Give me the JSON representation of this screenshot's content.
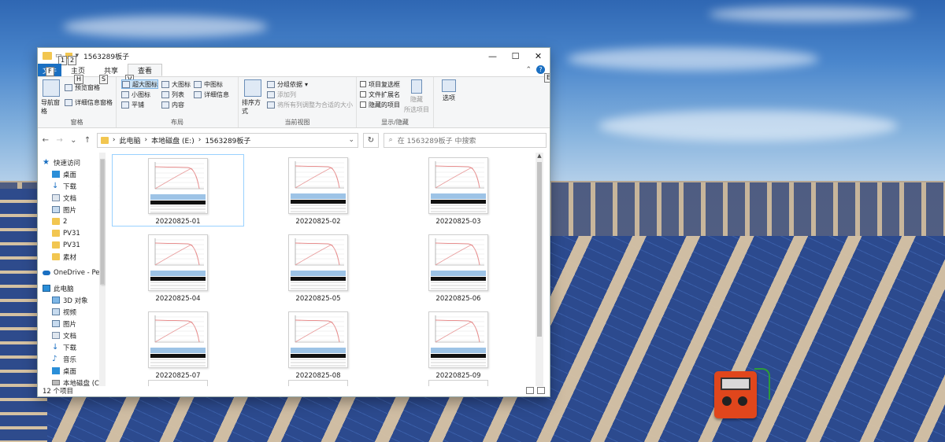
{
  "window": {
    "title": "1563289板子",
    "controls": {
      "minimize": "—",
      "maximize": "☐",
      "close": "✕"
    }
  },
  "keytips": {
    "qa1": "1",
    "qa2": "2",
    "file": "F",
    "home": "H",
    "share": "S",
    "view": "V",
    "help": "E"
  },
  "tabs": {
    "file": "文件",
    "home": "主页",
    "share": "共享",
    "view": "查看"
  },
  "ribbon": {
    "panes": {
      "label": "窗格",
      "nav_pane": "导航窗格",
      "preview": "预览窗格",
      "details": "详细信息窗格"
    },
    "layout": {
      "label": "布局",
      "options": [
        "超大图标",
        "大图标",
        "中图标",
        "小图标",
        "列表",
        "详细信息",
        "平铺",
        "内容"
      ],
      "selected": "超大图标"
    },
    "current_view": {
      "label": "当前视图",
      "sort": "排序方式",
      "group": "分组依据",
      "add_col": "添加列",
      "fit_cols": "将所有列调整为合适的大小"
    },
    "show_hide": {
      "label": "显示/隐藏",
      "item_checkbox": "项目复选框",
      "extensions": "文件扩展名",
      "hidden_items": "隐藏的项目",
      "hide": "隐藏",
      "selected_items": "所选项目"
    },
    "options": "选项"
  },
  "address": {
    "back": "←",
    "forward": "→",
    "recent": "⌄",
    "up": "↑",
    "segments": [
      "此电脑",
      "本地磁盘 (E:)",
      "1563289板子"
    ],
    "search_placeholder": "在 1563289板子 中搜索",
    "refresh": "↻"
  },
  "nav": {
    "quick_access": "快速访问",
    "quick_items": [
      {
        "label": "桌面",
        "icon": "desktop-icon",
        "pinned": true
      },
      {
        "label": "下载",
        "icon": "download-icon",
        "pinned": true
      },
      {
        "label": "文档",
        "icon": "document-icon",
        "pinned": true
      },
      {
        "label": "图片",
        "icon": "picture-icon",
        "pinned": true
      },
      {
        "label": "2",
        "icon": "folder-icon",
        "pinned": false
      },
      {
        "label": "PV31",
        "icon": "folder-icon",
        "pinned": false
      },
      {
        "label": "PV31",
        "icon": "folder-icon",
        "pinned": false
      },
      {
        "label": "素材",
        "icon": "folder-icon",
        "pinned": false
      }
    ],
    "onedrive": "OneDrive - Perso",
    "this_pc": "此电脑",
    "pc_items": [
      {
        "label": "3D 对象",
        "icon": "3d-objects-icon"
      },
      {
        "label": "视频",
        "icon": "video-icon"
      },
      {
        "label": "图片",
        "icon": "picture-icon"
      },
      {
        "label": "文档",
        "icon": "document-icon"
      },
      {
        "label": "下载",
        "icon": "download-icon"
      },
      {
        "label": "音乐",
        "icon": "music-icon"
      },
      {
        "label": "桌面",
        "icon": "desktop-icon"
      },
      {
        "label": "本地磁盘 (C:)",
        "icon": "disk-icon"
      }
    ]
  },
  "files": [
    {
      "name": "20220825-01",
      "selected": true
    },
    {
      "name": "20220825-02",
      "selected": false
    },
    {
      "name": "20220825-03",
      "selected": false
    },
    {
      "name": "20220825-04",
      "selected": false
    },
    {
      "name": "20220825-05",
      "selected": false
    },
    {
      "name": "20220825-06",
      "selected": false
    },
    {
      "name": "20220825-07",
      "selected": false
    },
    {
      "name": "20220825-08",
      "selected": false
    },
    {
      "name": "20220825-09",
      "selected": false
    }
  ],
  "status": {
    "count": "12 个项目"
  },
  "colors": {
    "accent": "#1a6fc2",
    "folder": "#f2c650",
    "selection": "#cce4f7"
  }
}
